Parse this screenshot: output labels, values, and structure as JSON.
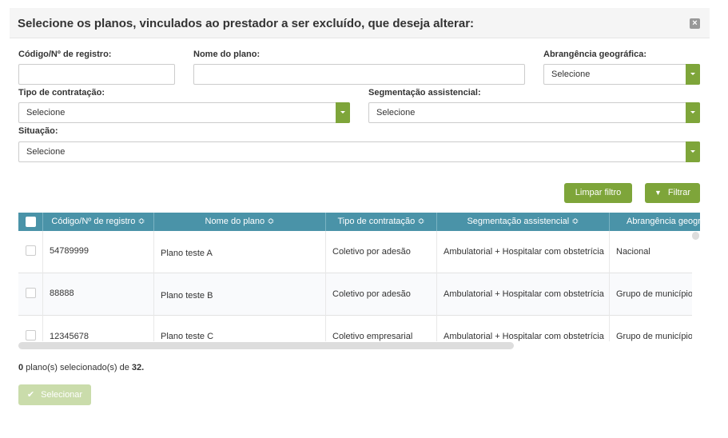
{
  "modal": {
    "title": "Selecione os planos, vinculados ao prestador a ser excluído, que deseja alterar:"
  },
  "filters": {
    "codigo_label": "Código/Nº de registro:",
    "codigo_value": "",
    "nome_label": "Nome do plano:",
    "nome_value": "",
    "abrangencia_label": "Abrangência geográfica:",
    "abrangencia_value": "Selecione",
    "tipo_label": "Tipo de contratação:",
    "tipo_value": "Selecione",
    "segmentacao_label": "Segmentação assistencial:",
    "segmentacao_value": "Selecione",
    "situacao_label": "Situação:",
    "situacao_value": "Selecione"
  },
  "buttons": {
    "clear": "Limpar filtro",
    "filter": "Filtrar",
    "select": "Selecionar"
  },
  "table": {
    "columns": [
      "Código/Nº de registro ≎",
      "Nome do plano ≎",
      "Tipo de contratação ≎",
      "Segmentação assistencial ≎",
      "Abrangência geográfica ≎"
    ],
    "rows": [
      [
        "54789999",
        "Plano teste A",
        "Coletivo por adesão",
        "Ambulatorial + Hospitalar com obstetrícia",
        "Nacional"
      ],
      [
        "88888",
        "Plano teste B",
        "Coletivo por adesão",
        "Ambulatorial + Hospitalar com obstetrícia",
        "Grupo de município"
      ],
      [
        "12345678",
        "Plano teste C",
        "Coletivo empresarial",
        "Ambulatorial + Hospitalar com obstetrícia",
        "Grupo de município"
      ]
    ]
  },
  "footer": {
    "selected": "0",
    "text": " plano(s) selecionado(s) de ",
    "total": "32."
  },
  "colors": {
    "accent": "#7ea53a",
    "header": "#4a93a8"
  }
}
